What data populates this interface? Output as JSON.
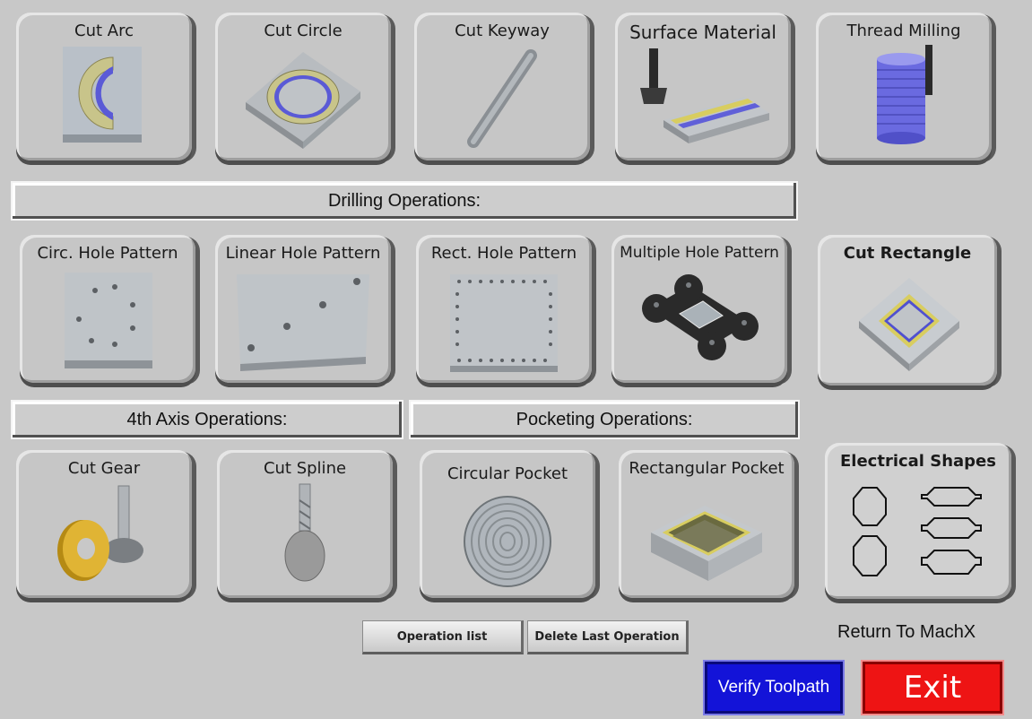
{
  "operations": {
    "cut_arc": "Cut Arc",
    "cut_circle": "Cut Circle",
    "cut_keyway": "Cut Keyway",
    "surface_material": "Surface Material",
    "thread_milling": "Thread Milling",
    "circ_hole_pattern": "Circ. Hole Pattern",
    "linear_hole_pattern": "Linear Hole Pattern",
    "rect_hole_pattern": "Rect. Hole Pattern",
    "multiple_hole_pattern": "Multiple Hole Pattern",
    "cut_rectangle": "Cut Rectangle",
    "cut_gear": "Cut Gear",
    "cut_spline": "Cut Spline",
    "circular_pocket": "Circular Pocket",
    "rectangular_pocket": "Rectangular Pocket",
    "electrical_shapes": "Electrical Shapes"
  },
  "sections": {
    "drilling": "Drilling Operations:",
    "fourth_axis": "4th Axis Operations:",
    "pocketing": "Pocketing Operations:"
  },
  "footer": {
    "operation_list": "Operation list",
    "delete_last": "Delete Last Operation",
    "return_text": "Return To MachX",
    "verify_toolpath": "Verify Toolpath",
    "exit": "Exit"
  },
  "colors": {
    "background": "#c8c8c8",
    "verify_bg": "#1313d8",
    "exit_bg": "#ee1414"
  }
}
